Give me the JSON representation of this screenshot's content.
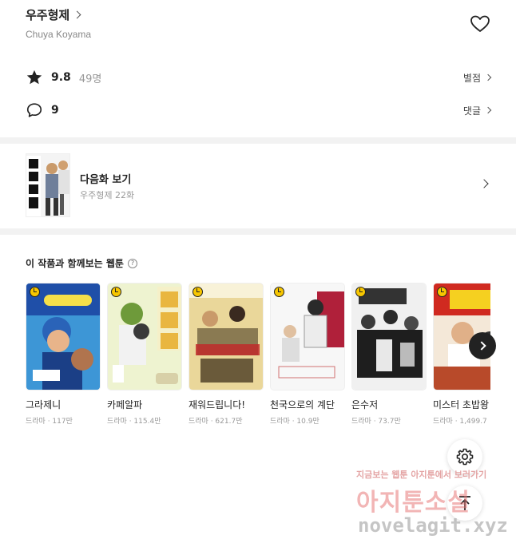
{
  "header": {
    "title": "우주형제",
    "author": "Chuya Koyama",
    "icons": {
      "title_chevron": "chevron-right-icon",
      "favorite": "heart-icon"
    }
  },
  "rating": {
    "score": "9.8",
    "count": "49명",
    "action_label": "별점",
    "icon": "star-icon"
  },
  "comments": {
    "count": "9",
    "action_label": "댓글",
    "icon": "speech-bubble-icon"
  },
  "next_episode": {
    "label": "다음화 보기",
    "episode": "우주형제 22화"
  },
  "recommendations": {
    "title": "이 작품과 함께보는 웹툰",
    "help_icon": "question-circle-icon",
    "next_icon": "chevron-right-icon",
    "items": [
      {
        "title": "그라제니",
        "genre": "드라마",
        "views": "117만",
        "meta": "드라마 · 117만",
        "cover_color": "#4aa3df"
      },
      {
        "title": "카페알파",
        "genre": "드라마",
        "views": "115.4만",
        "meta": "드라마 · 115.4만",
        "cover_color": "#e8efc8"
      },
      {
        "title": "재워드립니다!",
        "genre": "드라마",
        "views": "621.7만",
        "meta": "드라마 · 621.7만",
        "cover_color": "#e9d58a"
      },
      {
        "title": "천국으로의 계단",
        "genre": "드라마",
        "views": "10.9만",
        "meta": "드라마 · 10.9만",
        "cover_color": "#f4f4f4"
      },
      {
        "title": "은수저",
        "genre": "드라마",
        "views": "73.7만",
        "meta": "드라마 · 73.7만",
        "cover_color": "#d9d9d9"
      },
      {
        "title": "미스터 초밥왕",
        "genre": "드라마",
        "views": "1,499.7",
        "meta": "드라마 · 1,499.7",
        "cover_color": "#c94a3a"
      }
    ]
  },
  "floating": {
    "settings_icon": "gear-icon",
    "top_icon": "arrow-up-icon"
  },
  "watermark": {
    "line1": "지금보는 웹툰 아지툰에서 보러가기",
    "line2": "아지툰소설",
    "url": "novelagit.xyz"
  },
  "colors": {
    "separator": "#f2f2f2",
    "accent_dark": "#222222",
    "muted": "#999999"
  }
}
